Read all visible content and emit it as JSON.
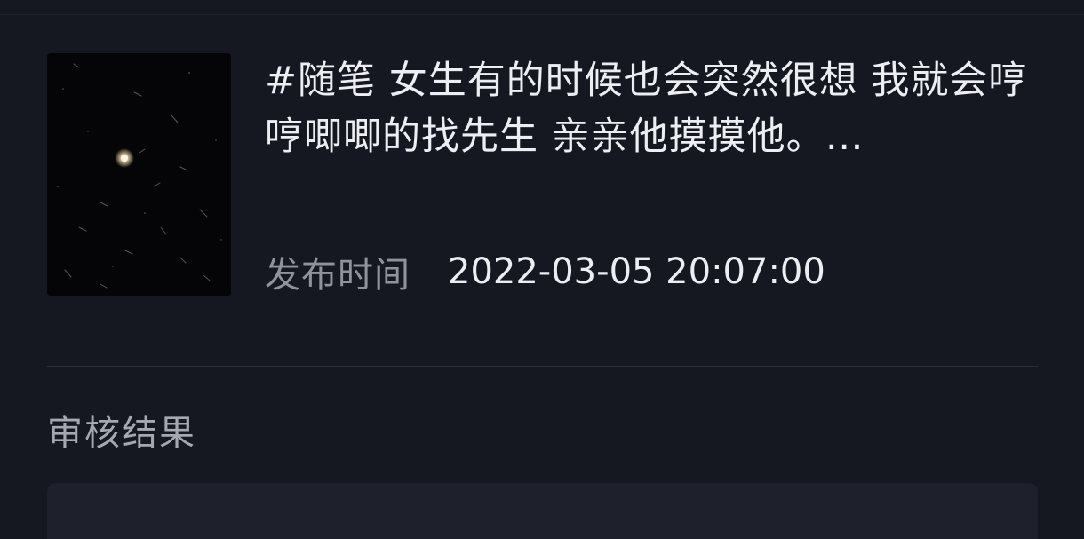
{
  "post": {
    "thumbnail_icon": "night-sky-photo",
    "text": "#随笔 女生有的时候也会突然很想 我就会哼哼唧唧的找先生 亲亲他摸摸他。…",
    "publish_label": "发布时间",
    "publish_time": "2022-03-05 20:07:00"
  },
  "review": {
    "title": "审核结果"
  },
  "colors": {
    "background": "#151821",
    "text_primary": "#eceef1",
    "text_secondary": "#8f939c",
    "panel": "#1e212b"
  }
}
